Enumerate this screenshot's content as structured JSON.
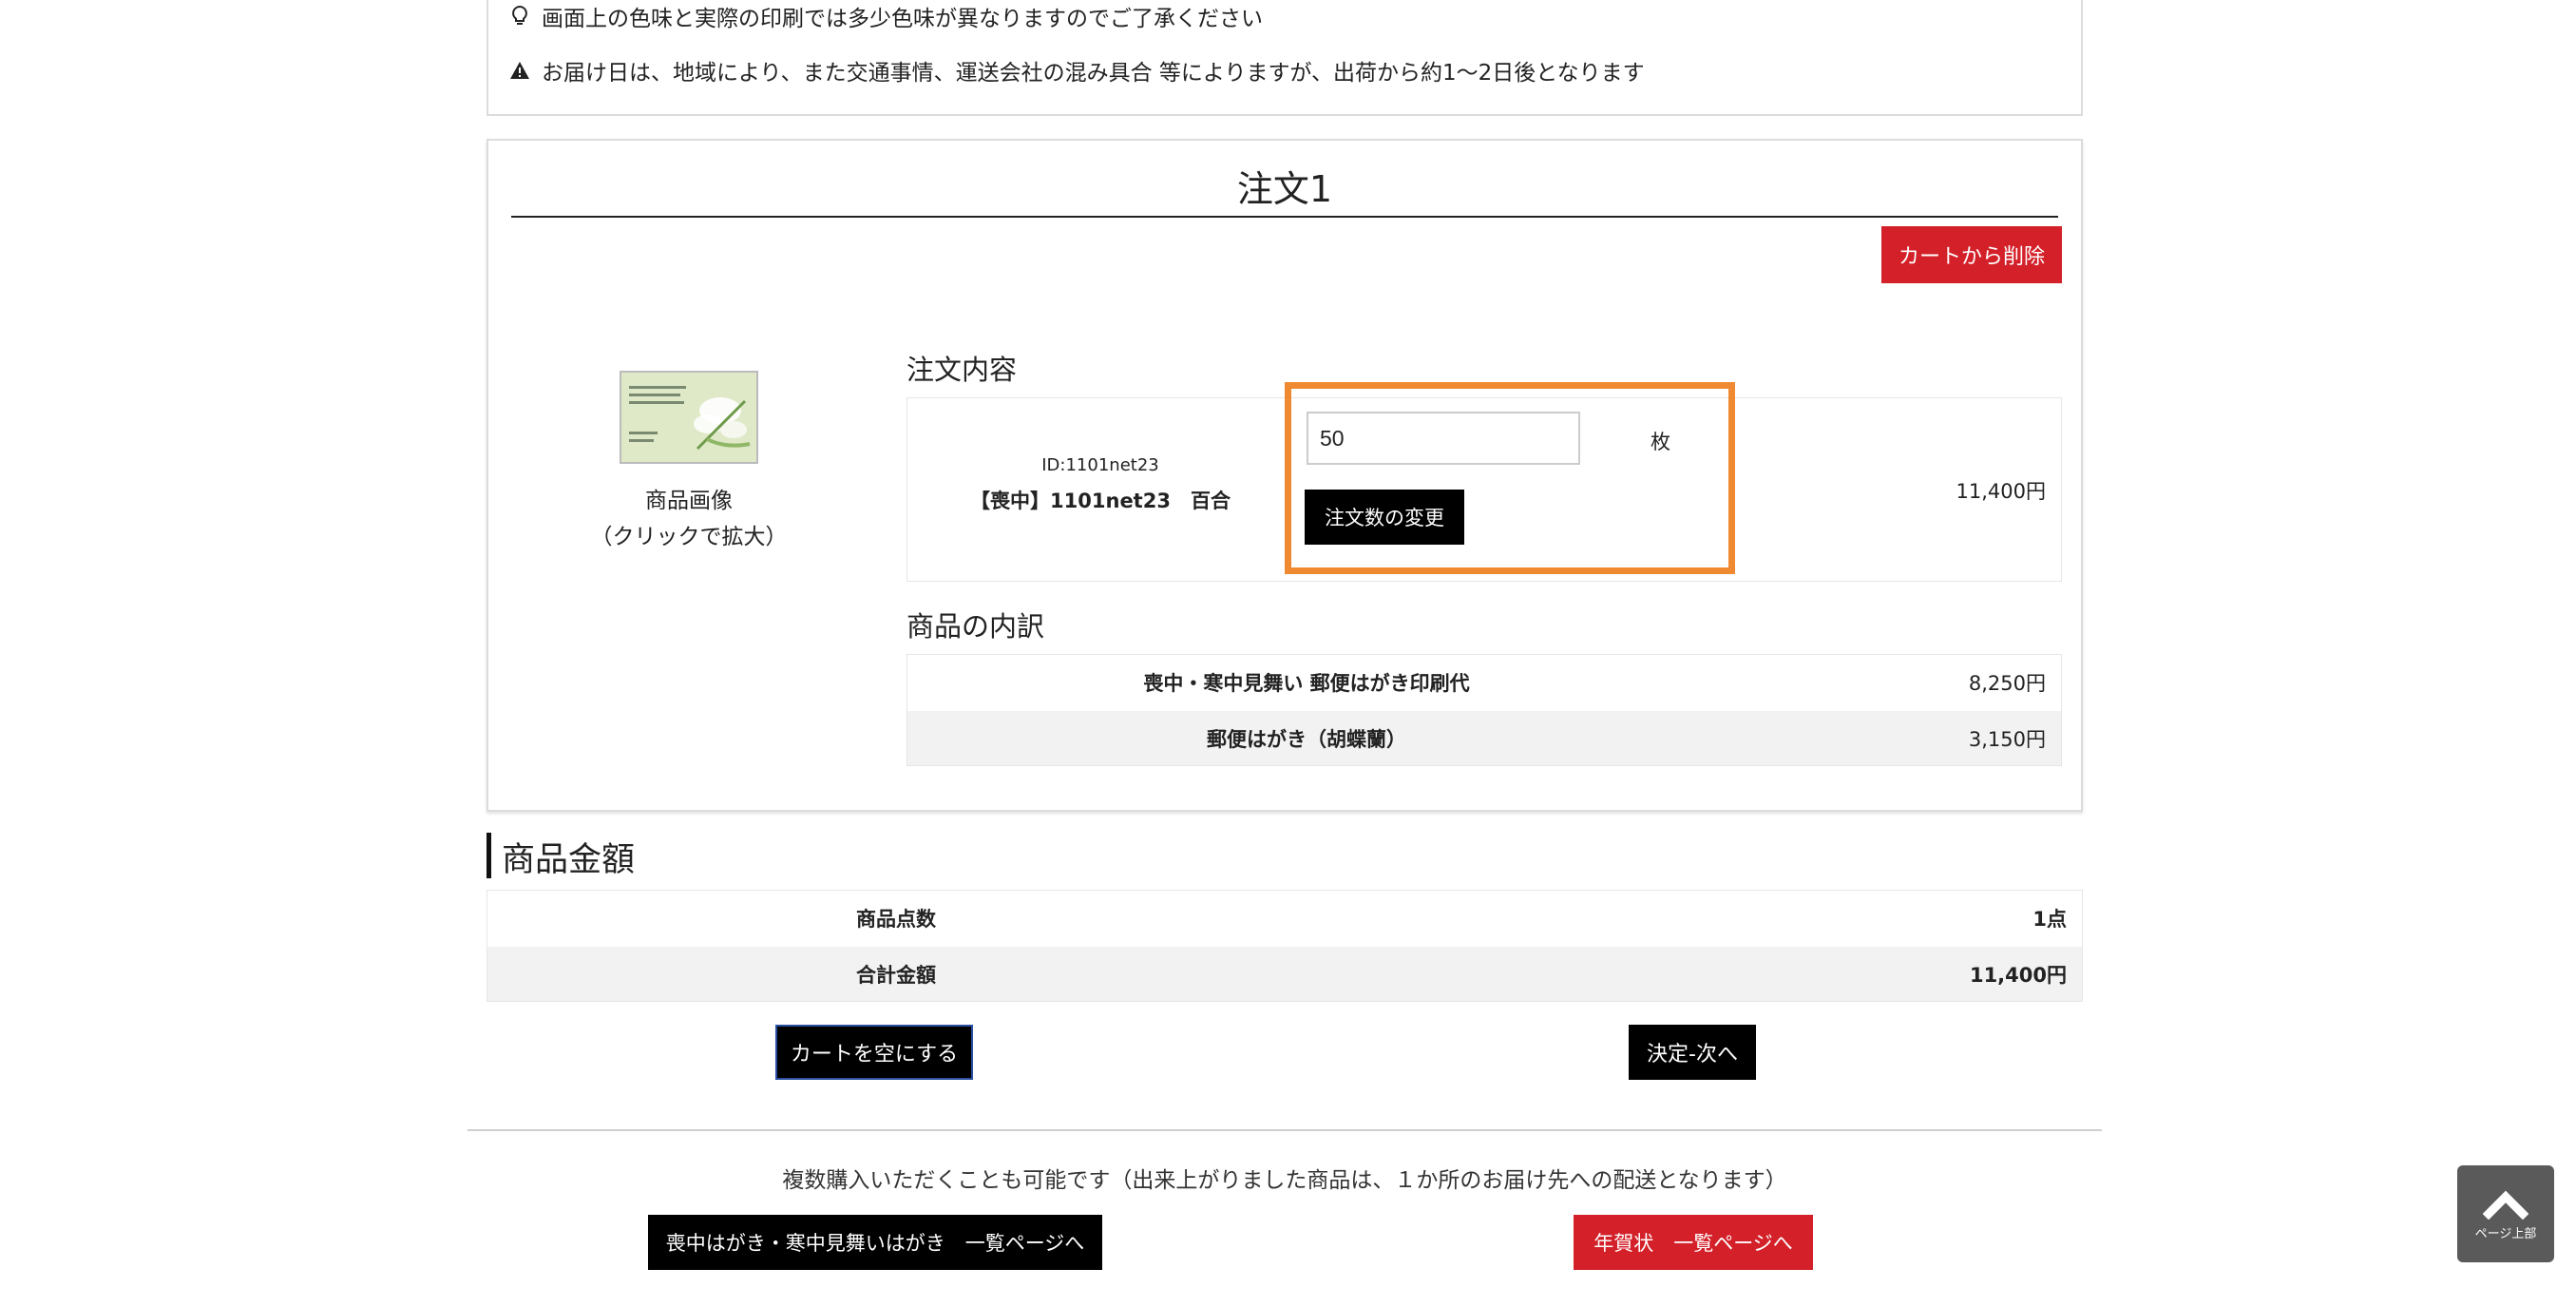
{
  "notices": {
    "color_note": "画面上の色味と実際の印刷では多少色味が異なりますのでご了承ください",
    "delivery_note": "お届け日は、地域により、また交通事情、運送会社の混み具合 等によりますが、出荷から約1〜2日後となります"
  },
  "order": {
    "title": "注文1",
    "remove_button": "カートから削除",
    "image_caption_line1": "商品画像",
    "image_caption_line2": "（クリックで拡大）",
    "contents_heading": "注文内容",
    "product_id": "ID:1101net23",
    "product_name": "【喪中】1101net23　百合",
    "quantity": "50",
    "unit": "枚",
    "change_qty_button": "注文数の変更",
    "line_price": "11,400円",
    "breakdown_heading": "商品の内訳",
    "breakdown": [
      {
        "name": "喪中・寒中見舞い 郵便はがき印刷代",
        "price": "8,250円"
      },
      {
        "name": "郵便はがき（胡蝶蘭）",
        "price": "3,150円"
      }
    ]
  },
  "summary": {
    "heading": "商品金額",
    "rows": [
      {
        "label": "商品点数",
        "value": "1点"
      },
      {
        "label": "合計金額",
        "value": "11,400円"
      }
    ]
  },
  "actions": {
    "empty_cart": "カートを空にする",
    "next": "決定-次へ"
  },
  "footer": {
    "multi_purchase_note": "複数購入いただくことも可能です（出来上がりました商品は、１か所のお届け先への配送となります）",
    "mourning_list_button": "喪中はがき・寒中見舞いはがき　一覧ページへ",
    "newyear_list_button": "年賀状　一覧ページへ"
  },
  "page_top": {
    "label": "ページ上部"
  },
  "colors": {
    "accent_red": "#d32029",
    "highlight_orange": "#ef8a33",
    "black": "#000000"
  }
}
